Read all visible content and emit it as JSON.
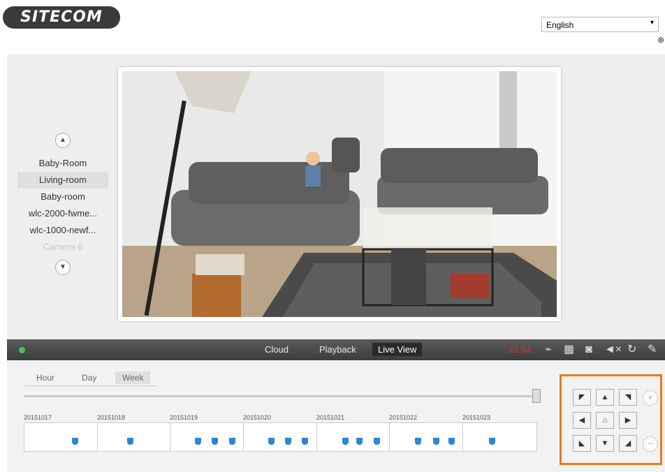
{
  "brand": {
    "logo_text": "SITECOM"
  },
  "language": {
    "selected": "English"
  },
  "cameras": {
    "items": [
      {
        "label": "Baby-Room",
        "state": "normal"
      },
      {
        "label": "Living-room",
        "state": "selected"
      },
      {
        "label": "Baby-room",
        "state": "normal"
      },
      {
        "label": "wlc-2000-fwme...",
        "state": "normal"
      },
      {
        "label": "wlc-1000-newf...",
        "state": "normal"
      },
      {
        "label": "Camera 6",
        "state": "disabled"
      }
    ]
  },
  "toolbar": {
    "tabs": [
      "Cloud",
      "Playback",
      "Live View"
    ],
    "active_tab": "Live View",
    "timer": "01:54",
    "icons": [
      "mic-off-icon",
      "grid-layout-icon",
      "snapshot-icon",
      "mute-icon",
      "refresh-icon",
      "settings-wrench-icon"
    ]
  },
  "timeline": {
    "ranges": [
      "Hour",
      "Day",
      "Week"
    ],
    "active_range": "Week",
    "dates": [
      "20151017",
      "20151018",
      "20151019",
      "20151020",
      "20151021",
      "20151022",
      "20151023"
    ],
    "markers_per_day": [
      1,
      1,
      3,
      3,
      3,
      3,
      1
    ]
  },
  "ptz": {
    "buttons": [
      "up-left",
      "up",
      "up-right",
      "left",
      "home",
      "right",
      "down-left",
      "down",
      "down-right"
    ],
    "zoom": [
      "+",
      "−"
    ]
  },
  "colors": {
    "accent": "#e87a1e",
    "status": "#4cc14c",
    "timer": "#e03030",
    "marker": "#2e86d0"
  }
}
